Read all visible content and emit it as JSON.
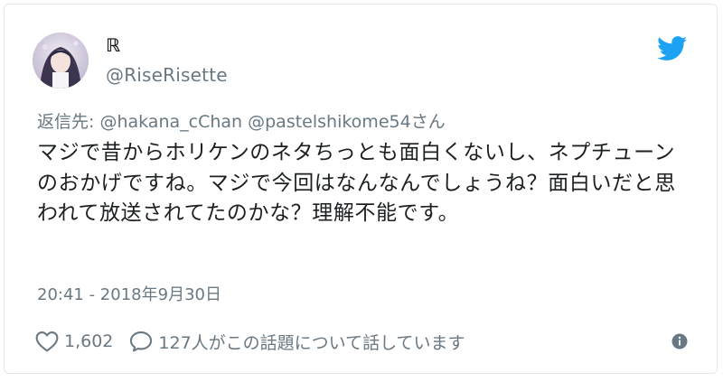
{
  "tweet": {
    "display_name": "ℝ",
    "handle": "@RiseRisette",
    "reply_prefix": "返信先: ",
    "reply_mentions": "@hakana_cChan @pastelshikome54",
    "reply_suffix": "さん",
    "text": "マジで昔からホリケンのネタちっとも面白くないし、ネプチューンのおかげですね。マジで今回はなんなんでしょうね？面白いだと思われて放送されてたのかな？理解不能です。",
    "timestamp": "20:41 - 2018年9月30日"
  },
  "actions": {
    "like_count": "1,602",
    "talk_label": "127人がこの話題について話しています"
  },
  "icons": {
    "brand": "twitter-bird-icon",
    "like": "heart-icon",
    "talk": "speech-bubble-icon",
    "info": "info-icon"
  },
  "colors": {
    "brand_blue": "#1da1f2",
    "muted_text": "#697882",
    "main_text": "#1c2022",
    "border": "#e1e8ed"
  }
}
